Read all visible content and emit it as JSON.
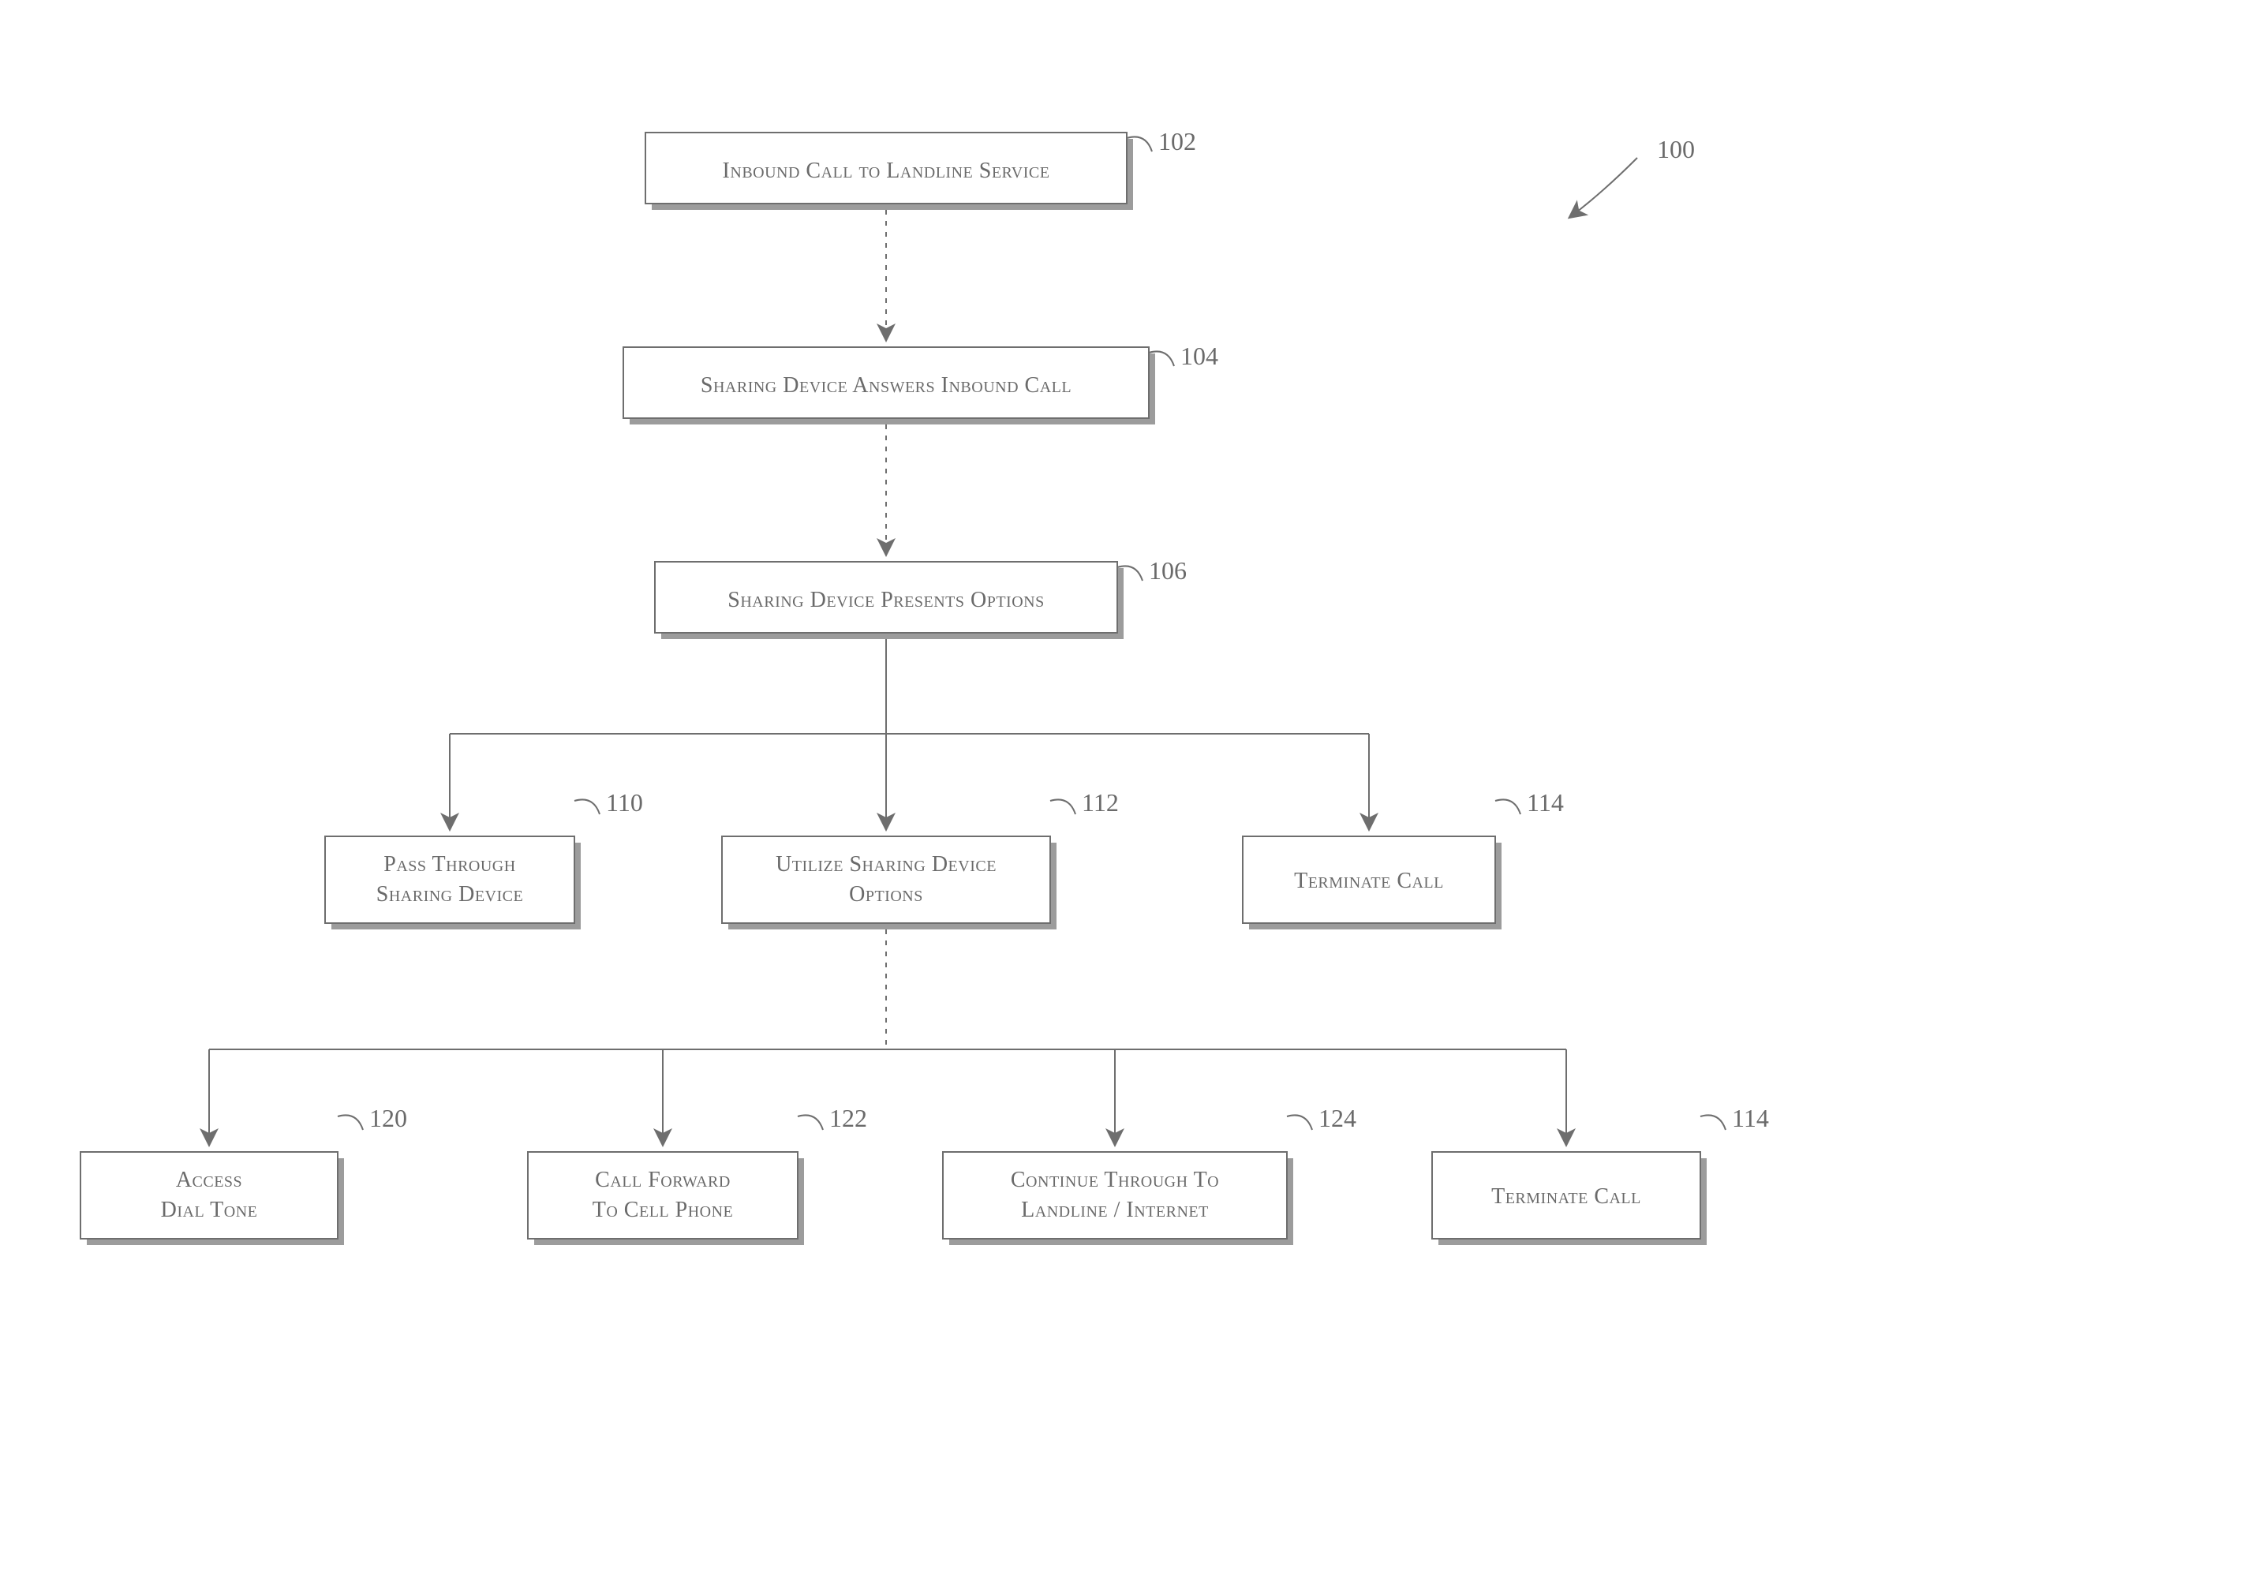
{
  "chart_data": {
    "type": "flowchart",
    "title_ref": "100",
    "nodes": [
      {
        "id": "102",
        "label": "Inbound Call to Landline Service"
      },
      {
        "id": "104",
        "label": "Sharing Device Answers Inbound Call"
      },
      {
        "id": "106",
        "label": "Sharing Device Presents Options"
      },
      {
        "id": "110",
        "label": "Pass Through Sharing Device"
      },
      {
        "id": "112",
        "label": "Utilize Sharing Device Options"
      },
      {
        "id": "114",
        "label": "Terminate Call"
      },
      {
        "id": "120",
        "label": "Access Dial Tone"
      },
      {
        "id": "122",
        "label": "Call Forward To Cell Phone"
      },
      {
        "id": "124",
        "label": "Continue Through To Landline / Internet"
      },
      {
        "id": "114b",
        "label": "Terminate Call"
      }
    ],
    "edges": [
      {
        "from": "102",
        "to": "104",
        "dashed": true
      },
      {
        "from": "104",
        "to": "106",
        "dashed": true
      },
      {
        "from": "106",
        "to": "110"
      },
      {
        "from": "106",
        "to": "112"
      },
      {
        "from": "106",
        "to": "114"
      },
      {
        "from": "112",
        "to": "120"
      },
      {
        "from": "112",
        "to": "122"
      },
      {
        "from": "112",
        "to": "124"
      },
      {
        "from": "112",
        "to": "114b"
      }
    ]
  },
  "refs": {
    "n100": "100",
    "n102": "102",
    "n104": "104",
    "n106": "106",
    "n110": "110",
    "n112": "112",
    "n114": "114",
    "n120": "120",
    "n122": "122",
    "n124": "124",
    "n114b": "114"
  },
  "labels": {
    "n102": "Inbound Call to Landline Service",
    "n104": "Sharing Device Answers Inbound Call",
    "n106": "Sharing Device Presents Options",
    "n110a": "Pass Through",
    "n110b": "Sharing Device",
    "n112a": "Utilize Sharing Device",
    "n112b": "Options",
    "n114": "Terminate Call",
    "n120a": "Access",
    "n120b": "Dial Tone",
    "n122a": "Call Forward",
    "n122b": "To Cell Phone",
    "n124a": "Continue Through To",
    "n124b": "Landline / Internet",
    "n114b": "Terminate Call"
  }
}
